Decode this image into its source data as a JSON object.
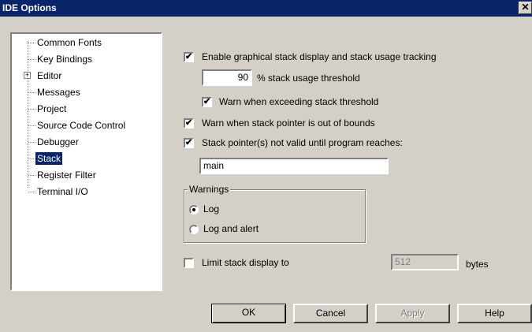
{
  "window": {
    "title": "IDE Options",
    "close_glyph": "✕"
  },
  "tree": {
    "items": [
      {
        "label": "Common Fonts",
        "selected": false
      },
      {
        "label": "Key Bindings",
        "selected": false
      },
      {
        "label": "Editor",
        "selected": false,
        "expandable": true,
        "expander_glyph": "+"
      },
      {
        "label": "Messages",
        "selected": false
      },
      {
        "label": "Project",
        "selected": false
      },
      {
        "label": "Source Code Control",
        "selected": false
      },
      {
        "label": "Debugger",
        "selected": false
      },
      {
        "label": "Stack",
        "selected": true
      },
      {
        "label": "Register Filter",
        "selected": false
      },
      {
        "label": "Terminal I/O",
        "selected": false
      }
    ]
  },
  "options": {
    "enable_graphical": {
      "label": "Enable graphical stack display and stack usage tracking",
      "checked": true
    },
    "threshold": {
      "value": "90",
      "label": "% stack usage threshold"
    },
    "warn_exceeding": {
      "label": "Warn when exceeding stack threshold",
      "checked": true
    },
    "warn_out_of_bounds": {
      "label": "Warn when stack pointer is out of bounds",
      "checked": true
    },
    "sp_not_valid": {
      "label": "Stack pointer(s) not valid until program reaches:",
      "checked": true
    },
    "program_reaches_value": "main",
    "limit_display": {
      "label": "Limit stack display to",
      "checked": false,
      "value": "512",
      "unit": "bytes"
    }
  },
  "warnings": {
    "title": "Warnings",
    "options": [
      {
        "label": "Log",
        "selected": true
      },
      {
        "label": "Log and alert",
        "selected": false
      }
    ]
  },
  "buttons": {
    "ok": "OK",
    "cancel": "Cancel",
    "apply": "Apply",
    "help": "Help"
  },
  "check_glyph": "✔"
}
